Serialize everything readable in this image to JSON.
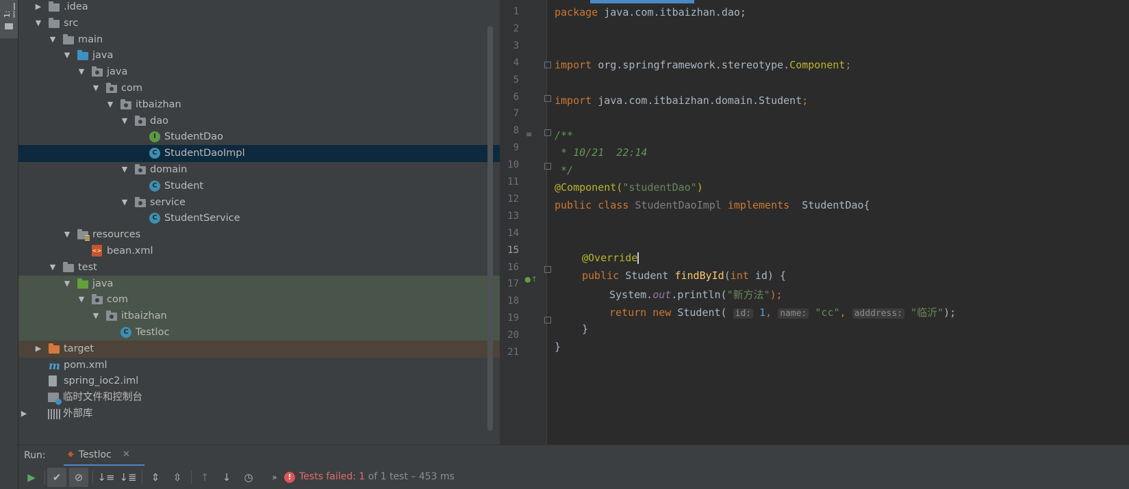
{
  "stripe": {
    "tab_label": "1: 项目"
  },
  "tree": [
    {
      "label": ".idea",
      "arrow": "▶",
      "icon": "folder"
    },
    {
      "label": "src",
      "arrow": "▼",
      "icon": "folder"
    },
    {
      "label": "main",
      "arrow": "▼",
      "icon": "folder"
    },
    {
      "label": "java",
      "arrow": "▼",
      "icon": "folder-blue"
    },
    {
      "label": "java",
      "arrow": "▼",
      "icon": "package"
    },
    {
      "label": "com",
      "arrow": "▼",
      "icon": "package"
    },
    {
      "label": "itbaizhan",
      "arrow": "▼",
      "icon": "package"
    },
    {
      "label": "dao",
      "arrow": "▼",
      "icon": "package"
    },
    {
      "label": "StudentDao",
      "arrow": "",
      "icon": "interface"
    },
    {
      "label": "StudentDaoImpl",
      "arrow": "",
      "icon": "class"
    },
    {
      "label": "domain",
      "arrow": "▼",
      "icon": "package"
    },
    {
      "label": "Student",
      "arrow": "",
      "icon": "class"
    },
    {
      "label": "service",
      "arrow": "▼",
      "icon": "package"
    },
    {
      "label": "StudentService",
      "arrow": "",
      "icon": "class"
    },
    {
      "label": "resources",
      "arrow": "▼",
      "icon": "resources-folder"
    },
    {
      "label": "bean.xml",
      "arrow": "",
      "icon": "xml"
    },
    {
      "label": "test",
      "arrow": "▼",
      "icon": "folder"
    },
    {
      "label": "java",
      "arrow": "▼",
      "icon": "folder-green"
    },
    {
      "label": "com",
      "arrow": "▼",
      "icon": "package"
    },
    {
      "label": "itbaizhan",
      "arrow": "▼",
      "icon": "package"
    },
    {
      "label": "Testloc",
      "arrow": "",
      "icon": "test-class"
    },
    {
      "label": "target",
      "arrow": "▶",
      "icon": "folder-orange"
    },
    {
      "label": "pom.xml",
      "arrow": "",
      "icon": "maven"
    },
    {
      "label": "spring_ioc2.iml",
      "arrow": "",
      "icon": "iml"
    },
    {
      "label": "临时文件和控制台",
      "arrow": "",
      "icon": "scratches"
    },
    {
      "label": "外部库",
      "arrow": "▶",
      "icon": "library"
    }
  ],
  "editor": {
    "line_numbers": [
      "1",
      "2",
      "3",
      "4",
      "5",
      "6",
      "7",
      "8",
      "9",
      "10",
      "11",
      "12",
      "13",
      "14",
      "15",
      "16",
      "17",
      "18",
      "19",
      "20",
      "21"
    ],
    "lines": {
      "l1_kw": "package",
      "l1_rest": " java.com.itbaizhan.dao;",
      "l4_kw": "import",
      "l4_pkg": " org.springframework.stereotype.",
      "l4_cls": "Component",
      "l4_semi": ";",
      "l6_kw": "import",
      "l6_rest": " java.com.itbaizhan.domain.Student",
      "l6_semi": ";",
      "l8": "/**",
      "l9": " * 10/21  22:14",
      "l10": " */",
      "l11_ann": "@Component(",
      "l11_str": "\"studentDao\"",
      "l11_close": ")",
      "l12_kw1": "public class ",
      "l12_name": "StudentDaoImpl ",
      "l12_kw2": "implements",
      "l12_rest": "  StudentDao{",
      "l15_ann": "@Override",
      "l16_kw": "public ",
      "l16_type": "Student ",
      "l16_fn": "findById",
      "l16_p1": "(",
      "l16_kw2": "int",
      "l16_p2": " id) {",
      "l17_a": "System.",
      "l17_field": "out",
      "l17_b": ".println(",
      "l17_str": "\"新方法\"",
      "l17_c": ");",
      "l18_kw": "return new ",
      "l18_a": "Student( ",
      "l18_h1": "id:",
      "l18_num": " 1",
      "l18_c1": ", ",
      "l18_h2": "name:",
      "l18_s1": " \"cc\"",
      "l18_c2": ", ",
      "l18_h3": "adddress:",
      "l18_s2": " \"临沂\"",
      "l18_end": ");",
      "l19": "}",
      "l20": "}"
    }
  },
  "run": {
    "label": "Run:",
    "tab_label": "Testloc",
    "status_prefix": "Tests failed: ",
    "failed_count": "1",
    "status_suffix": " of 1 test – 453 ms"
  },
  "colors": {
    "keyword": "#cc7832",
    "string": "#6a8759",
    "annotation": "#bbb529",
    "selection": "#0d293e",
    "error": "#e06c6c"
  }
}
